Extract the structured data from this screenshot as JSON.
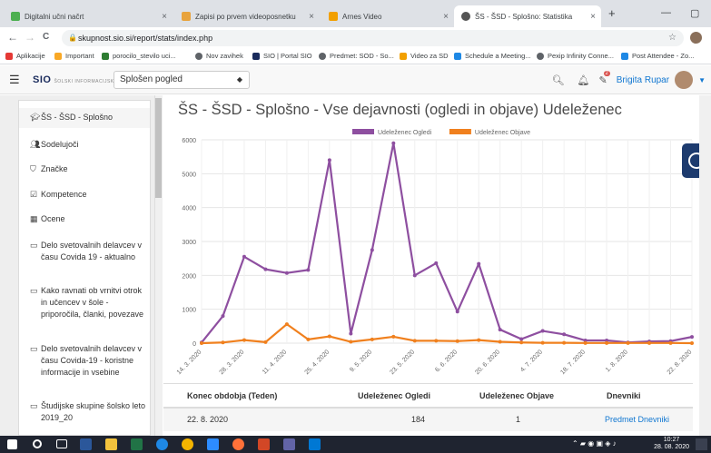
{
  "tabs": [
    {
      "label": "Digitalni učni načrt",
      "color": "#4caf50"
    },
    {
      "label": "Zapisi po prvem videoposnetku",
      "color": "#e8a33d"
    },
    {
      "label": "Arnes Video",
      "color": "#f2a000"
    },
    {
      "label": "ŠS - ŠSD - Splošno: Statistika",
      "color": "#555555"
    }
  ],
  "new_tab": "+",
  "tab_close": "×",
  "window_controls": {
    "minimize": "—",
    "maximize": "▢"
  },
  "nav": {
    "back": "←",
    "forward": "→",
    "reload": "C"
  },
  "url": "skupnost.sio.si/report/stats/index.php",
  "url_star": "☆",
  "bookmarks": [
    {
      "label": "Aplikacije",
      "color": "#e53935"
    },
    {
      "label": "Important",
      "color": "#f9a825"
    },
    {
      "label": "porocilo_stevilo uci...",
      "color": "#2e7d32"
    },
    {
      "label": "Nov zavihek",
      "color": "#5f6368"
    },
    {
      "label": "SIO | Portal SIO",
      "color": "#1a2b5c"
    },
    {
      "label": "Predmet: SOD - So...",
      "color": "#5f6368"
    },
    {
      "label": "Video za SD",
      "color": "#f2a000"
    },
    {
      "label": "Schedule a Meeting...",
      "color": "#1e88e5"
    },
    {
      "label": "Pexip Infinity Conne...",
      "color": "#5f6368"
    },
    {
      "label": "Post Attendee - Zo...",
      "color": "#1e88e5"
    }
  ],
  "header": {
    "logo": "SIO",
    "logo_sub": "ŠOLSKI INFORMACIJSKI OMREŽJE",
    "select_value": "Splošen pogled",
    "user_name": "Brigita Rupar",
    "notification_count": "2"
  },
  "sidebar": {
    "items": [
      {
        "icon": "graduation-cap-icon",
        "glyph": "🎓",
        "label": "ŠS - ŠSD - Splošno"
      },
      {
        "icon": "users-icon",
        "glyph": "👥",
        "label": "Sodelujoči"
      },
      {
        "icon": "shield-icon",
        "glyph": "⛉",
        "label": "Značke"
      },
      {
        "icon": "check-square-icon",
        "glyph": "☑",
        "label": "Kompetence"
      },
      {
        "icon": "table-icon",
        "glyph": "▦",
        "label": "Ocene"
      },
      {
        "icon": "folder-icon",
        "glyph": "🗀",
        "label": "Delo svetovalnih delavcev v času Covida 19 - aktualno"
      },
      {
        "icon": "folder-icon",
        "glyph": "🗀",
        "label": "Kako ravnati ob vrnitvi otrok in učencev v šole - priporočila, članki, povezave"
      },
      {
        "icon": "folder-icon",
        "glyph": "🗀",
        "label": "Delo svetovalnih delavcev v času Covida-19 - koristne informacije in vsebine"
      },
      {
        "icon": "folder-icon",
        "glyph": "🗀",
        "label": "Študijske skupine šolsko leto 2019_20"
      }
    ]
  },
  "page_title": "ŠS - ŠSD - Splošno - Vse dejavnosti (ogledi in objave) Udeleženec",
  "chart_data": {
    "type": "line",
    "title": "",
    "x": [
      "14. 3. 2020",
      "21. 3. 2020",
      "28. 3. 2020",
      "4. 4. 2020",
      "11. 4. 2020",
      "18. 4. 2020",
      "25. 4. 2020",
      "2. 5. 2020",
      "9. 5. 2020",
      "16. 5. 2020",
      "23. 5. 2020",
      "30. 5. 2020",
      "6. 6. 2020",
      "13. 6. 2020",
      "20. 6. 2020",
      "27. 6. 2020",
      "4. 7. 2020",
      "11. 7. 2020",
      "18. 7. 2020",
      "25. 7. 2020",
      "1. 8. 2020",
      "8. 8. 2020",
      "15. 8. 2020",
      "22. 8. 2020"
    ],
    "xtick_labels": [
      "14. 3. 2020",
      "28. 3. 2020",
      "11. 4. 2020",
      "25. 4. 2020",
      "9. 5. 2020",
      "23. 5. 2020",
      "6. 6. 2020",
      "20. 6. 2020",
      "4. 7. 2020",
      "18. 7. 2020",
      "1. 8. 2020",
      "22. 8. 2020"
    ],
    "series": [
      {
        "name": "Udeleženec Ogledi",
        "color": "#8e4fa0",
        "values": [
          20,
          800,
          2550,
          2180,
          2070,
          2160,
          5400,
          280,
          2750,
          5900,
          2000,
          2360,
          930,
          2340,
          400,
          120,
          360,
          260,
          80,
          80,
          20,
          50,
          60,
          184
        ]
      },
      {
        "name": "Udeleženec Objave",
        "color": "#f0801e",
        "values": [
          0,
          20,
          90,
          30,
          560,
          110,
          200,
          40,
          110,
          190,
          70,
          70,
          60,
          90,
          40,
          20,
          10,
          10,
          5,
          5,
          5,
          5,
          5,
          1
        ]
      }
    ],
    "ylim": [
      0,
      6000
    ],
    "yticks": [
      0,
      1000,
      2000,
      3000,
      4000,
      5000,
      6000
    ],
    "legend": "top-center",
    "grid": true
  },
  "table": {
    "headers": [
      "Konec obdobja (Teden)",
      "Udeleženec Ogledi",
      "Udeleženec Objave",
      "Dnevniki"
    ],
    "rows": [
      [
        "22. 8. 2020",
        "184",
        "1",
        "Predmet Dnevniki"
      ]
    ]
  },
  "taskbar": {
    "time": "10:27",
    "date": "28. 08. 2020"
  }
}
